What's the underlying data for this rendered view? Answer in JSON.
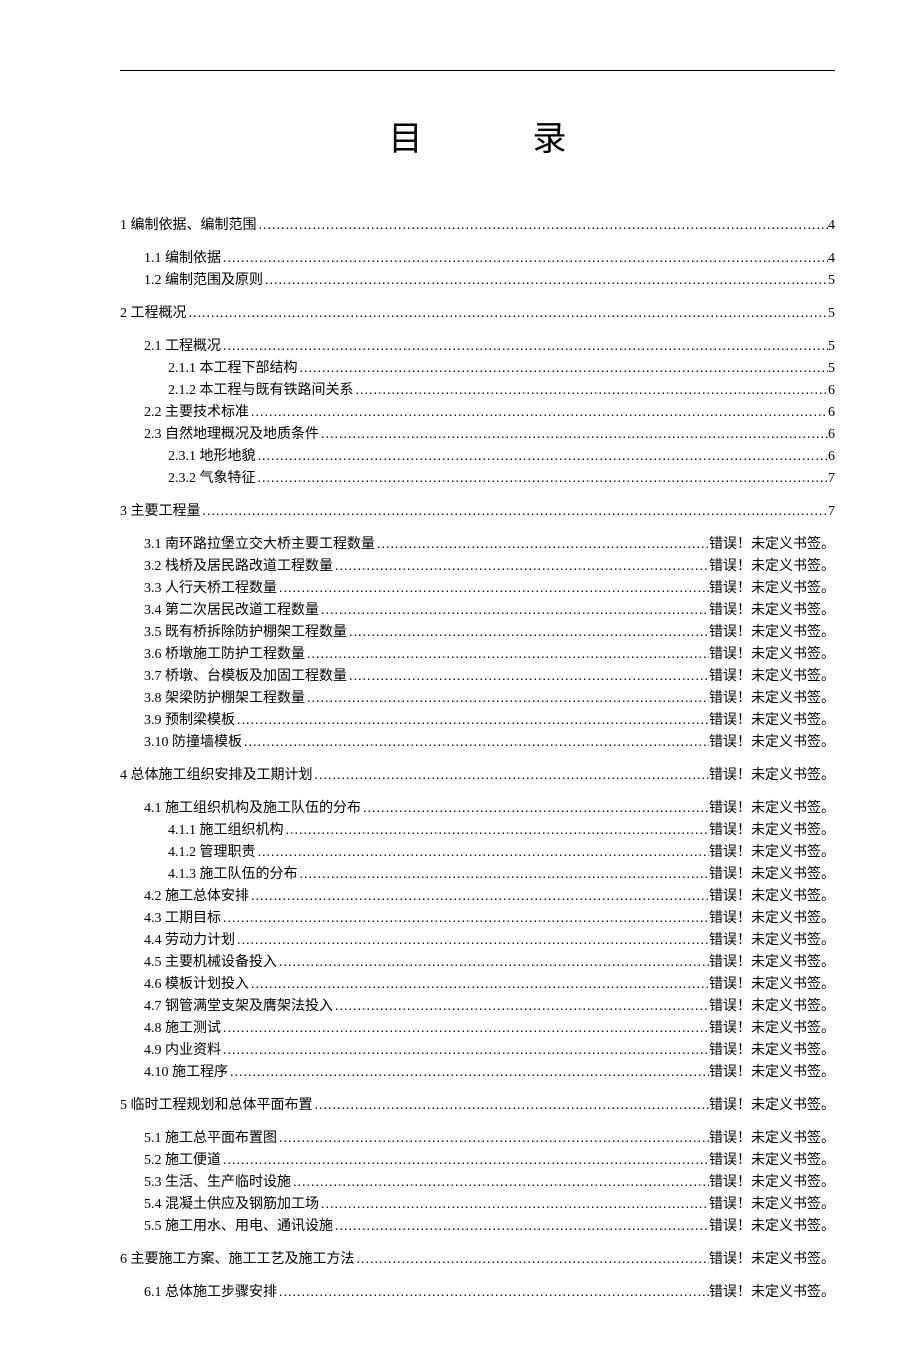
{
  "title": "目录",
  "error_text": "错误！未定义书签。",
  "toc": [
    {
      "level": 0,
      "label": "1 编制依据、编制范围",
      "page": "4",
      "gap_before": false
    },
    {
      "level": 1,
      "label": "1.1 编制依据",
      "page": "4",
      "gap_before": true
    },
    {
      "level": 1,
      "label": "1.2 编制范围及原则",
      "page": "5",
      "gap_before": false
    },
    {
      "level": 0,
      "label": "2 工程概况",
      "page": "5",
      "gap_before": true
    },
    {
      "level": 1,
      "label": "2.1 工程概况",
      "page": "5",
      "gap_before": true
    },
    {
      "level": 2,
      "label": "2.1.1 本工程下部结构",
      "page": "5",
      "gap_before": false
    },
    {
      "level": 2,
      "label": "2.1.2 本工程与既有铁路间关系",
      "page": "6",
      "gap_before": false
    },
    {
      "level": 1,
      "label": "2.2 主要技术标准",
      "page": "6",
      "gap_before": false
    },
    {
      "level": 1,
      "label": "2.3 自然地理概况及地质条件",
      "page": "6",
      "gap_before": false
    },
    {
      "level": 2,
      "label": "2.3.1 地形地貌",
      "page": "6",
      "gap_before": false
    },
    {
      "level": 2,
      "label": "2.3.2 气象特征",
      "page": "7",
      "gap_before": false
    },
    {
      "level": 0,
      "label": "3 主要工程量",
      "page": "7",
      "gap_before": true
    },
    {
      "level": 1,
      "label": "3.1 南环路拉堡立交大桥主要工程数量",
      "page": "ERR",
      "gap_before": true
    },
    {
      "level": 1,
      "label": "3.2 栈桥及居民路改道工程数量",
      "page": "ERR",
      "gap_before": false
    },
    {
      "level": 1,
      "label": "3.3 人行天桥工程数量",
      "page": "ERR",
      "gap_before": false
    },
    {
      "level": 1,
      "label": "3.4 第二次居民改道工程数量",
      "page": "ERR",
      "gap_before": false
    },
    {
      "level": 1,
      "label": "3.5 既有桥拆除防护棚架工程数量",
      "page": "ERR",
      "gap_before": false
    },
    {
      "level": 1,
      "label": "3.6 桥墩施工防护工程数量",
      "page": "ERR",
      "gap_before": false
    },
    {
      "level": 1,
      "label": "3.7 桥墩、台模板及加固工程数量",
      "page": "ERR",
      "gap_before": false
    },
    {
      "level": 1,
      "label": "3.8 架梁防护棚架工程数量",
      "page": "ERR",
      "gap_before": false
    },
    {
      "level": 1,
      "label": "3.9 预制梁模板",
      "page": "ERR",
      "gap_before": false
    },
    {
      "level": 1,
      "label": "3.10 防撞墙模板",
      "page": "ERR",
      "gap_before": false
    },
    {
      "level": 0,
      "label": "4 总体施工组织安排及工期计划",
      "page": "ERR",
      "gap_before": true
    },
    {
      "level": 1,
      "label": "4.1 施工组织机构及施工队伍的分布",
      "page": "ERR",
      "gap_before": true
    },
    {
      "level": 2,
      "label": "4.1.1 施工组织机构",
      "page": "ERR",
      "gap_before": false
    },
    {
      "level": 2,
      "label": "4.1.2 管理职责",
      "page": "ERR",
      "gap_before": false
    },
    {
      "level": 2,
      "label": "4.1.3 施工队伍的分布",
      "page": "ERR",
      "gap_before": false
    },
    {
      "level": 1,
      "label": "4.2 施工总体安排",
      "page": "ERR",
      "gap_before": false
    },
    {
      "level": 1,
      "label": "4.3 工期目标",
      "page": "ERR",
      "gap_before": false
    },
    {
      "level": 1,
      "label": "4.4 劳动力计划",
      "page": "ERR",
      "gap_before": false
    },
    {
      "level": 1,
      "label": "4.5 主要机械设备投入",
      "page": "ERR",
      "gap_before": false
    },
    {
      "level": 1,
      "label": "4.6 模板计划投入",
      "page": "ERR",
      "gap_before": false
    },
    {
      "level": 1,
      "label": "4.7 钢管满堂支架及膺架法投入",
      "page": "ERR",
      "gap_before": false
    },
    {
      "level": 1,
      "label": "4.8 施工测试",
      "page": "ERR",
      "gap_before": false
    },
    {
      "level": 1,
      "label": "4.9 内业资料",
      "page": "ERR",
      "gap_before": false
    },
    {
      "level": 1,
      "label": "4.10 施工程序",
      "page": "ERR",
      "gap_before": false
    },
    {
      "level": 0,
      "label": "5 临时工程规划和总体平面布置",
      "page": "ERR",
      "gap_before": true
    },
    {
      "level": 1,
      "label": "5.1 施工总平面布置图",
      "page": "ERR",
      "gap_before": true
    },
    {
      "level": 1,
      "label": "5.2 施工便道",
      "page": "ERR",
      "gap_before": false
    },
    {
      "level": 1,
      "label": "5.3 生活、生产临时设施",
      "page": "ERR",
      "gap_before": false
    },
    {
      "level": 1,
      "label": "5.4 混凝土供应及钢筋加工场",
      "page": "ERR",
      "gap_before": false
    },
    {
      "level": 1,
      "label": "5.5 施工用水、用电、通讯设施",
      "page": "ERR",
      "gap_before": false
    },
    {
      "level": 0,
      "label": "6 主要施工方案、施工工艺及施工方法",
      "page": "ERR",
      "gap_before": true
    },
    {
      "level": 1,
      "label": "6.1 总体施工步骤安排",
      "page": "ERR",
      "gap_before": true
    }
  ]
}
